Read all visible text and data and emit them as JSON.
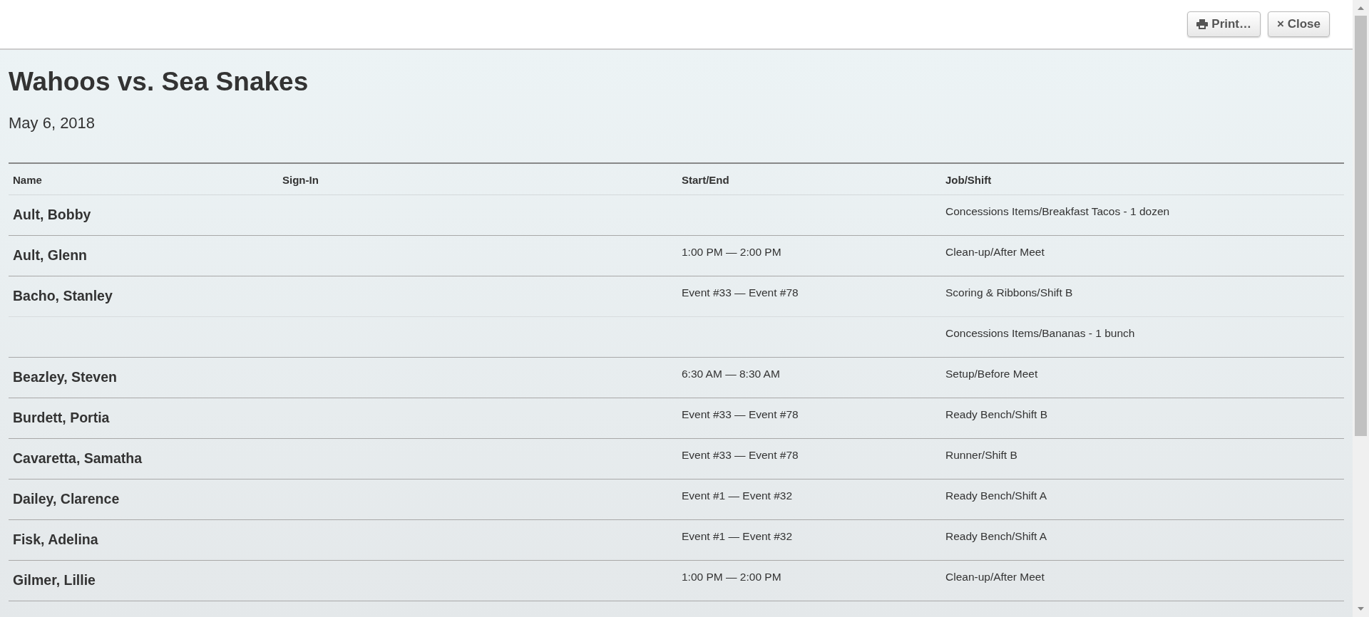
{
  "toolbar": {
    "buttons": [
      {
        "kind": "print",
        "label": "Print…"
      },
      {
        "kind": "close",
        "label": "× Close"
      }
    ]
  },
  "title": "Wahoos vs. Sea Snakes",
  "date": "May 6, 2018",
  "table": {
    "columns": [
      "Name",
      "Sign-In",
      "Start/End",
      "Job/Shift"
    ],
    "rows": [
      {
        "name": "Ault, Bobby",
        "job": "Concessions Items/Breakfast Tacos - 1 dozen"
      },
      {
        "name": "Ault, Glenn",
        "start_end": "1:00 PM — 2:00 PM",
        "job": "Clean-up/After Meet"
      },
      {
        "name": "Bacho, Stanley",
        "start_end": "Event #33 — Event #78",
        "job": "Scoring & Ribbons/Shift B"
      },
      {
        "job": "Concessions Items/Bananas - 1 bunch"
      },
      {
        "name": "Beazley, Steven",
        "start_end": "6:30 AM — 8:30 AM",
        "job": "Setup/Before Meet"
      },
      {
        "name": "Burdett, Portia",
        "start_end": "Event #33 — Event #78",
        "job": "Ready Bench/Shift B"
      },
      {
        "name": "Cavaretta, Samatha",
        "start_end": "Event #33 — Event #78",
        "job": "Runner/Shift B"
      },
      {
        "name": "Dailey, Clarence",
        "start_end": "Event #1 — Event #32",
        "job": "Ready Bench/Shift A"
      },
      {
        "name": "Fisk, Adelina",
        "start_end": "Event #1 — Event #32",
        "job": "Ready Bench/Shift A"
      },
      {
        "name": "Gilmer, Lillie",
        "start_end": "1:00 PM — 2:00 PM",
        "job": "Clean-up/After Meet"
      }
    ]
  }
}
